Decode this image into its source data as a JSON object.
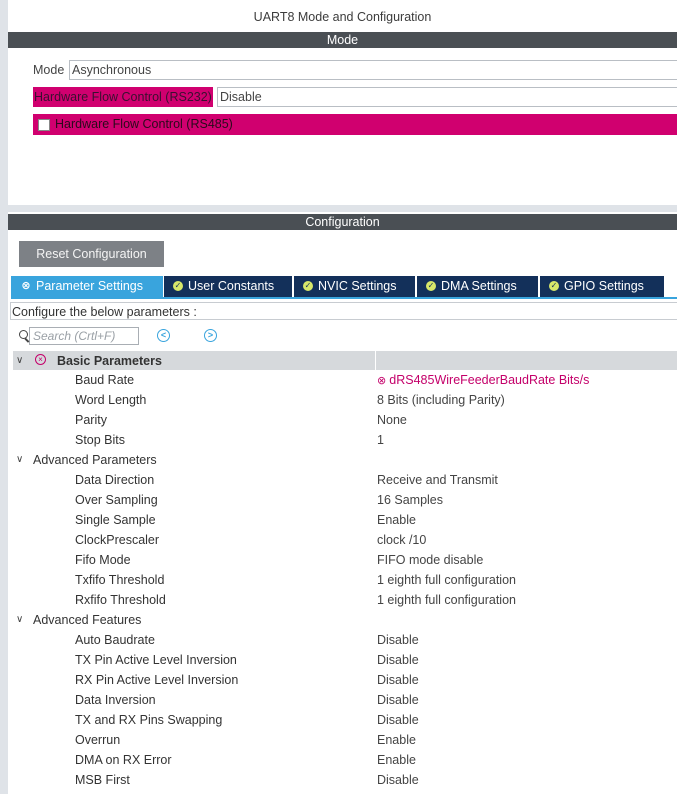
{
  "window": {
    "title": "UART8 Mode and Configuration"
  },
  "mode_section": {
    "header": "Mode",
    "mode_label": "Mode",
    "mode_value": "Asynchronous",
    "hfc_rs232_label": "Hardware Flow Control (RS232)",
    "hfc_rs232_value": "Disable",
    "hfc_rs485_label": "Hardware Flow Control (RS485)",
    "hfc_rs485_checked": false
  },
  "config_section": {
    "header": "Configuration",
    "reset_button": "Reset Configuration",
    "tabs": [
      {
        "label": "Parameter Settings",
        "active": true,
        "icon": "error-icon"
      },
      {
        "label": "User Constants",
        "active": false,
        "icon": "check-icon"
      },
      {
        "label": "NVIC Settings",
        "active": false,
        "icon": "check-icon"
      },
      {
        "label": "DMA Settings",
        "active": false,
        "icon": "check-icon"
      },
      {
        "label": "GPIO Settings",
        "active": false,
        "icon": "check-icon"
      }
    ],
    "configure_text": "Configure the below parameters :",
    "search_placeholder": "Search (Crtl+F)"
  },
  "groups": {
    "basic": {
      "title": "Basic Parameters",
      "params": [
        {
          "name": "Baud Rate",
          "value": "dRS485WireFeederBaudRate Bits/s"
        },
        {
          "name": "Word Length",
          "value": "8 Bits (including Parity)"
        },
        {
          "name": "Parity",
          "value": "None"
        },
        {
          "name": "Stop Bits",
          "value": "1"
        }
      ]
    },
    "advanced": {
      "title": "Advanced Parameters",
      "params": [
        {
          "name": "Data Direction",
          "value": "Receive and Transmit"
        },
        {
          "name": "Over Sampling",
          "value": "16 Samples"
        },
        {
          "name": "Single Sample",
          "value": "Enable"
        },
        {
          "name": "ClockPrescaler",
          "value": "clock /10"
        },
        {
          "name": "Fifo Mode",
          "value": "FIFO mode disable"
        },
        {
          "name": "Txfifo Threshold",
          "value": "1 eighth full configuration"
        },
        {
          "name": "Rxfifo Threshold",
          "value": "1 eighth full configuration"
        }
      ]
    },
    "features": {
      "title": "Advanced Features",
      "params": [
        {
          "name": "Auto Baudrate",
          "value": "Disable"
        },
        {
          "name": "TX Pin Active Level Inversion",
          "value": "Disable"
        },
        {
          "name": "RX Pin Active Level Inversion",
          "value": "Disable"
        },
        {
          "name": "Data Inversion",
          "value": "Disable"
        },
        {
          "name": "TX and RX Pins Swapping",
          "value": "Disable"
        },
        {
          "name": "Overrun",
          "value": "Enable"
        },
        {
          "name": "DMA on RX Error",
          "value": "Enable"
        },
        {
          "name": "MSB First",
          "value": "Disable"
        }
      ]
    }
  },
  "colors": {
    "header_bar": "#4a4f54",
    "error_pink": "#d0006f",
    "tab_active": "#39a4dd",
    "tab_inactive": "#13305a",
    "check_icon": "#d8e86a"
  }
}
